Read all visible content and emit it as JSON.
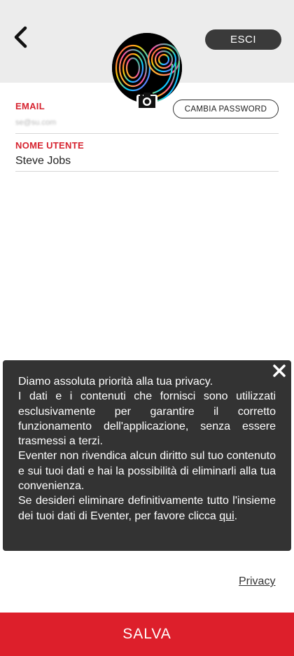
{
  "header": {
    "back_icon": "chevron-left-icon",
    "logout_label": "ESCI"
  },
  "profile": {
    "avatar_icon": "avatar-image",
    "camera_icon": "camera-icon",
    "change_password_label": "CAMBIA PASSWORD"
  },
  "form": {
    "email_label": "EMAIL",
    "email_value": "se@su.com",
    "username_label": "NOME UTENTE",
    "username_value": "Steve Jobs"
  },
  "privacy_popup": {
    "close_icon": "close-icon",
    "line1": "Diamo assoluta priorità alla tua privacy.",
    "paragraph2": "I dati e i contenuti che fornisci sono utilizzati esclusivamente per garantire il corretto funzionamento dell'applicazione, senza essere trasmessi a terzi.",
    "paragraph3": "Eventer non rivendica alcun diritto sul tuo contenuto e sui tuoi dati e hai la possibilità di eliminarli alla tua convenienza.",
    "paragraph4": "Se desideri eliminare definitivamente tutto l'insieme dei tuoi dati di Eventer, per favore clicca",
    "link_label": "qui",
    "link_suffix": "."
  },
  "footer": {
    "privacy_label": "Privacy",
    "save_label": "SALVA"
  },
  "colors": {
    "accent": "#dd1f2b",
    "label_red": "#d6232f",
    "dark_button": "#3a3a3a",
    "popup_bg": "#333333"
  }
}
